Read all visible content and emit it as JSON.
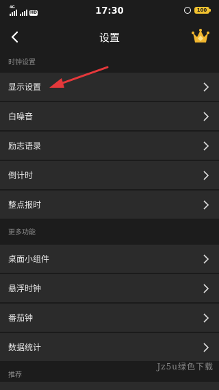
{
  "status_bar": {
    "network_label": "4G",
    "hd_label": "HD",
    "time": "17:30",
    "battery": "100"
  },
  "nav": {
    "title": "设置",
    "back_icon": "chevron-left-icon",
    "vip_icon": "crown-icon"
  },
  "sections": [
    {
      "header": "时钟设置",
      "items": [
        {
          "label": "显示设置"
        },
        {
          "label": "白噪音"
        },
        {
          "label": "励志语录"
        },
        {
          "label": "倒计时"
        },
        {
          "label": "整点报时"
        }
      ]
    },
    {
      "header": "更多功能",
      "items": [
        {
          "label": "桌面小组件"
        },
        {
          "label": "悬浮时钟"
        },
        {
          "label": "番茄钟"
        },
        {
          "label": "数据统计"
        }
      ]
    },
    {
      "header": "推荐",
      "items": []
    }
  ],
  "watermark": "Jz5u绿色下载",
  "colors": {
    "background": "#1c1c1c",
    "row_background": "#2b2b2b",
    "annotation_arrow": "#e5383b",
    "crown_gold": "#f2b72f",
    "battery": "#f2c230"
  }
}
